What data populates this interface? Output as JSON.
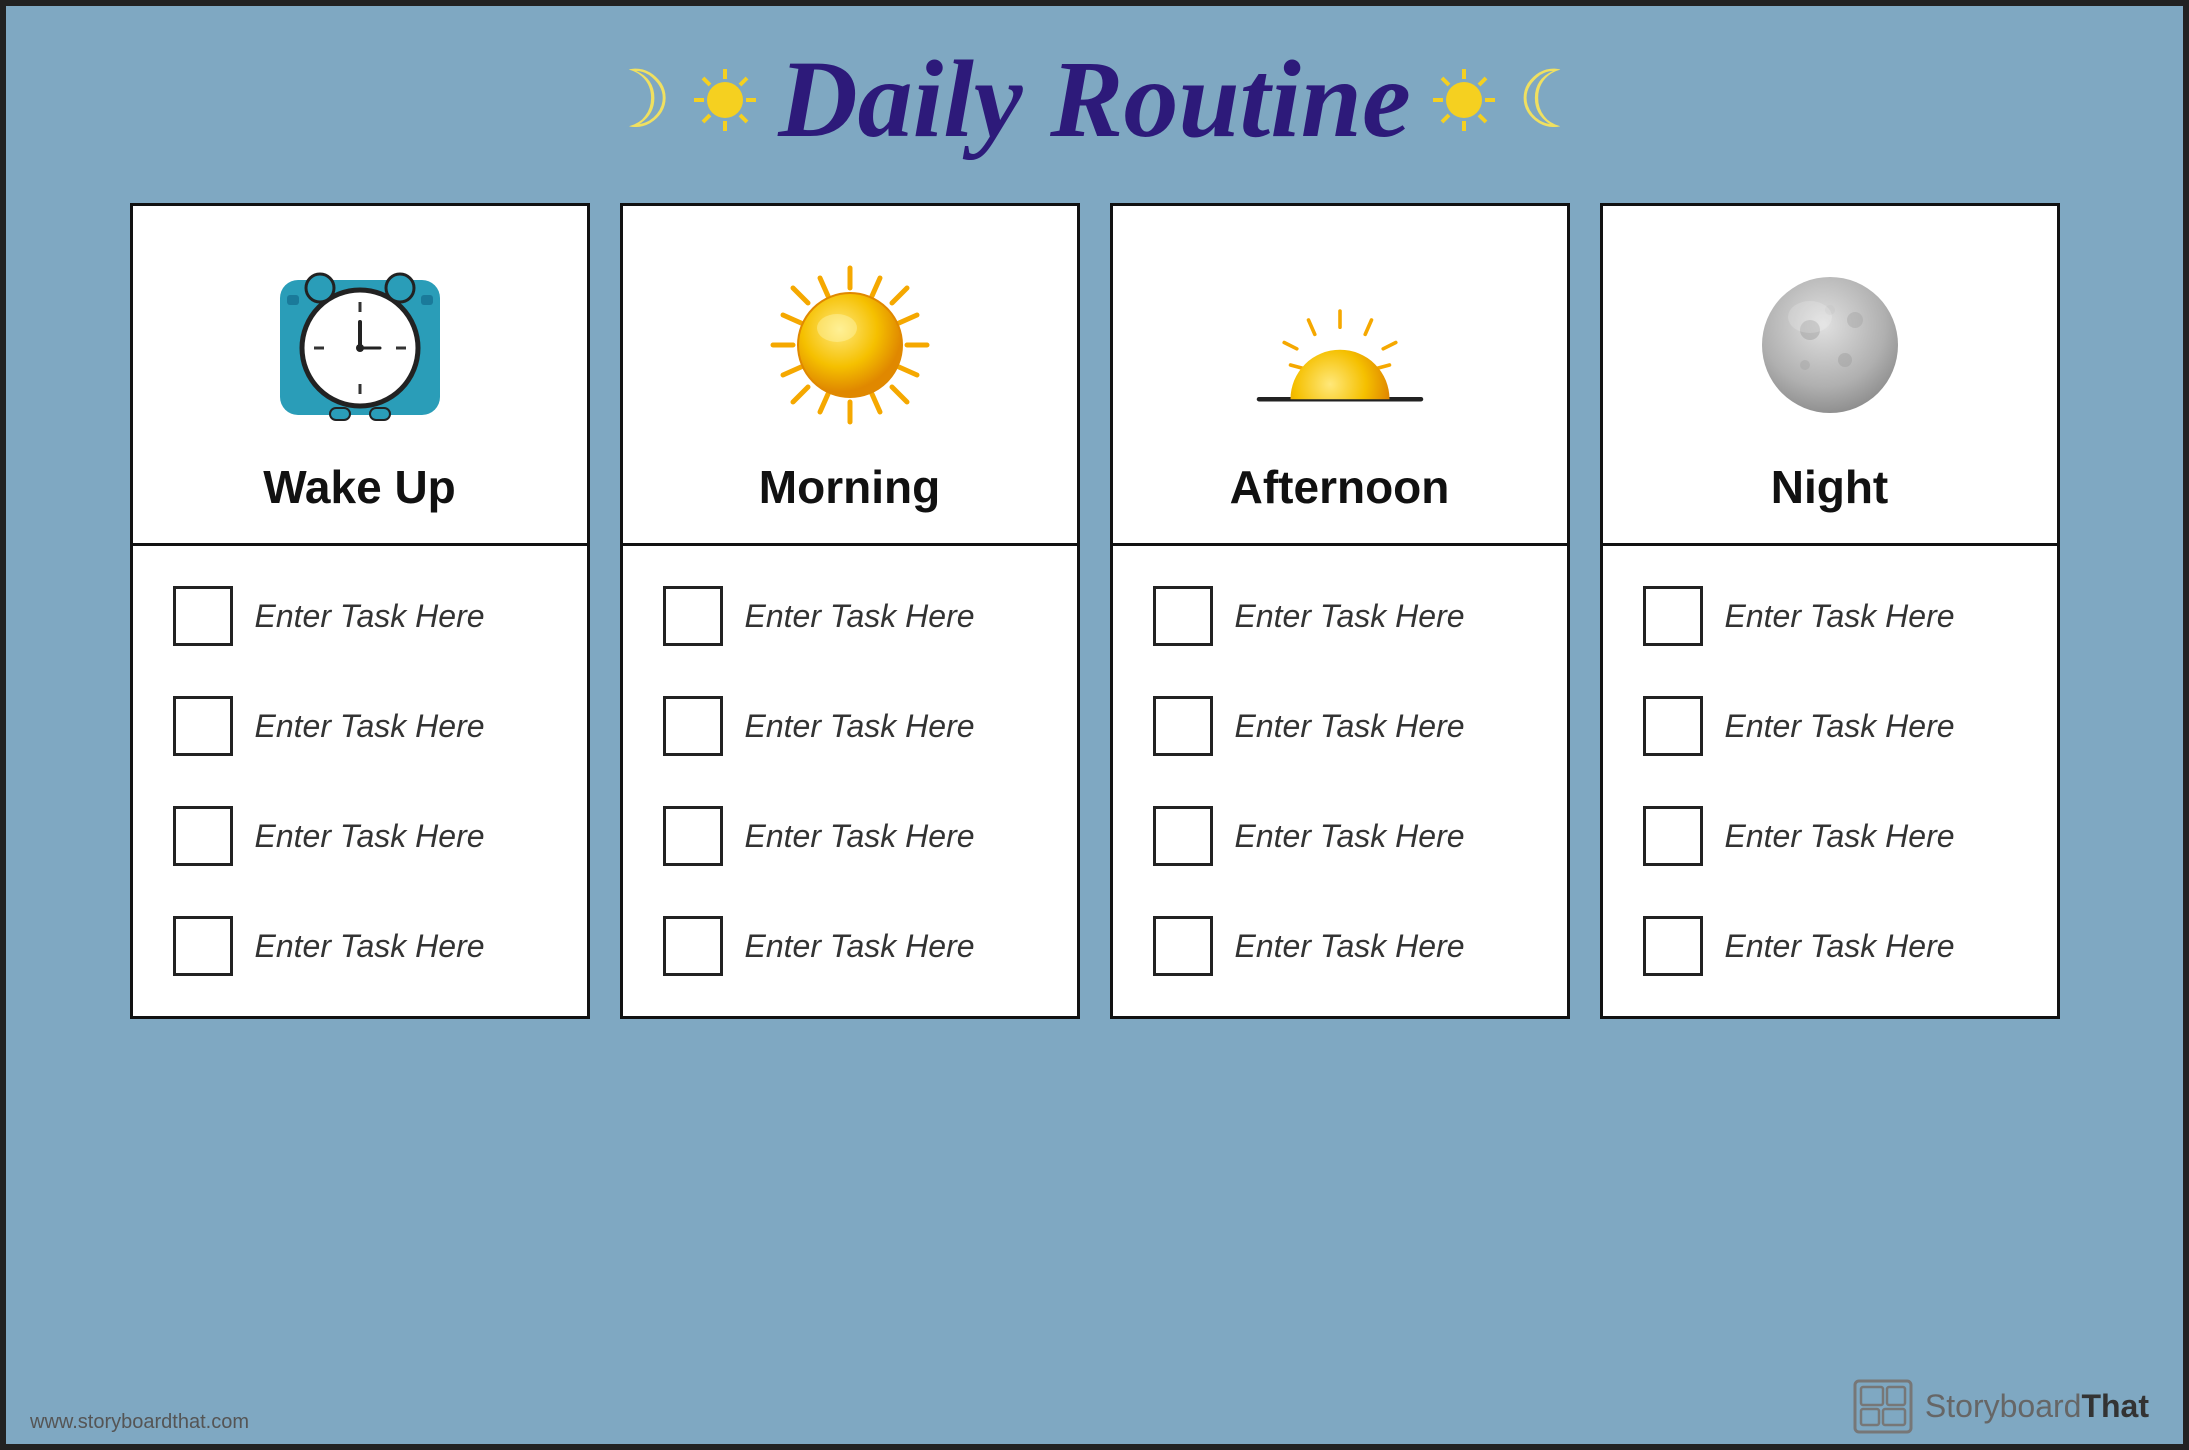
{
  "page": {
    "background_color": "#7fa8c2",
    "title": "Daily Routine",
    "footer_url": "www.storyboardthat.com",
    "brand_name": "Storyboard",
    "brand_name_bold": "That"
  },
  "header": {
    "title": "Daily Routine",
    "moon_symbol": "☽",
    "sun_symbol": "✦"
  },
  "columns": [
    {
      "id": "wake-up",
      "label": "Wake Up",
      "icon_type": "clock",
      "tasks": [
        "Enter Task Here",
        "Enter Task Here",
        "Enter Task Here",
        "Enter Task Here"
      ]
    },
    {
      "id": "morning",
      "label": "Morning",
      "icon_type": "sun-full",
      "tasks": [
        "Enter Task Here",
        "Enter Task Here",
        "Enter Task Here",
        "Enter Task Here"
      ]
    },
    {
      "id": "afternoon",
      "label": "Afternoon",
      "icon_type": "sun-horizon",
      "tasks": [
        "Enter Task Here",
        "Enter Task Here",
        "Enter Task Here",
        "Enter Task Here"
      ]
    },
    {
      "id": "night",
      "label": "Night",
      "icon_type": "moon",
      "tasks": [
        "Enter Task Here",
        "Enter Task Here",
        "Enter Task Here",
        "Enter Task Here"
      ]
    }
  ]
}
